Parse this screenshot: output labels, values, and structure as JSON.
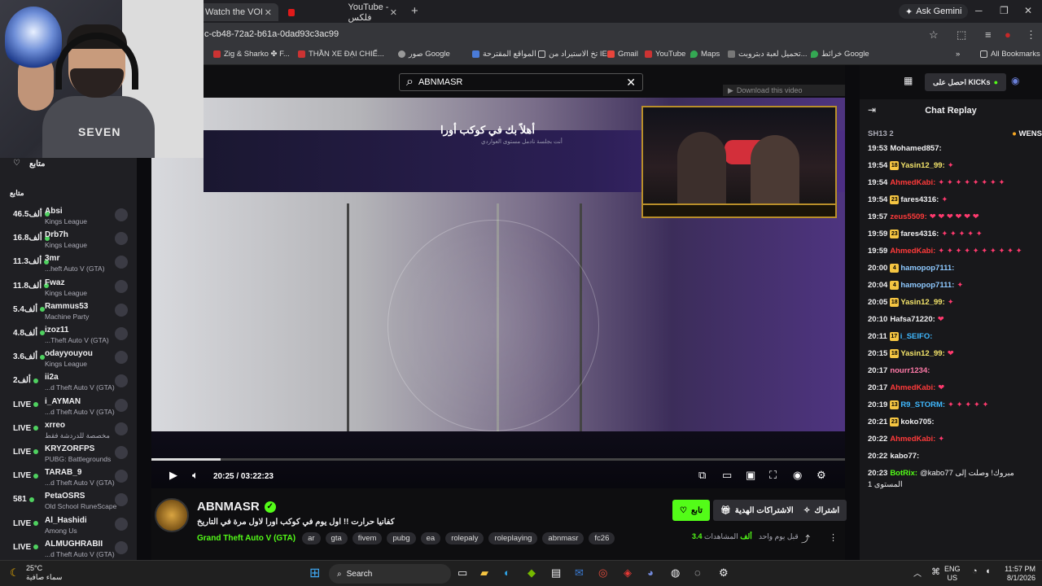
{
  "browser": {
    "tabs": [
      {
        "label": "Watch the VOD on",
        "close": "✕"
      },
      {
        "label": "YouTube - فلكس",
        "close": "✕"
      }
    ],
    "new_tab": "+",
    "ask_gemini": "Ask Gemini",
    "url": "c-cb48-72a2-b61a-0dad93c3ac99",
    "bookmarks": [
      "Zig & Sharko ✤ F...",
      "THẦN XE ĐẠI CHIẾ...",
      "صور Google",
      "المواقع المقترحة",
      "تخ الاستيراد من IE",
      "Gmail",
      "YouTube",
      "Maps",
      "تحميل لعبة دبتروبت...",
      "خرائط Google"
    ],
    "all_bookmarks": "All Bookmarks"
  },
  "webcam": {
    "shirt_text": "SEVEN"
  },
  "sidebar": {
    "following_label": "متابع",
    "section_label": "متابع",
    "channels": [
      {
        "count": "46.5",
        "unit": "ألف",
        "name": "Absi",
        "game": "Kings League"
      },
      {
        "count": "16.8",
        "unit": "ألف",
        "name": "Drb7h",
        "game": "Kings League"
      },
      {
        "count": "11.3",
        "unit": "ألف",
        "name": "3mr",
        "game": "...heft Auto V (GTA)"
      },
      {
        "count": "11.8",
        "unit": "ألف",
        "name": "Fwaz",
        "game": "Kings League"
      },
      {
        "count": "5.4",
        "unit": "ألف",
        "name": "Rammus53",
        "game": "Machine Party"
      },
      {
        "count": "4.8",
        "unit": "ألف",
        "name": "izoz11",
        "game": "...Theft Auto V (GTA)"
      },
      {
        "count": "3.6",
        "unit": "ألف",
        "name": "odayyouyou",
        "game": "Kings League"
      },
      {
        "count": "2",
        "unit": "ألف",
        "name": "ii2a",
        "game": "...d Theft Auto V (GTA)"
      },
      {
        "count": "LIVE",
        "unit": "",
        "name": "i_AYMAN",
        "game": "...d Theft Auto V (GTA)"
      },
      {
        "count": "LIVE",
        "unit": "",
        "name": "xrreo",
        "game": "مخصصة للدردشة فقط"
      },
      {
        "count": "LIVE",
        "unit": "",
        "name": "KRYZORFPS",
        "game": "PUBG: Battlegrounds"
      },
      {
        "count": "LIVE",
        "unit": "",
        "name": "TARAB_9",
        "game": "...d Theft Auto V (GTA)"
      },
      {
        "count": "581",
        "unit": "",
        "name": "PetaOSRS",
        "game": "Old School RuneScape"
      },
      {
        "count": "LIVE",
        "unit": "",
        "name": "Al_Hashidi",
        "game": "Among Us"
      },
      {
        "count": "LIVE",
        "unit": "",
        "name": "ALMUGHRABII",
        "game": "...d Theft Auto V (GTA)"
      }
    ]
  },
  "player": {
    "search_value": "ABNMASR",
    "download_label": "Download this video",
    "video_title": "أهلاً بك في كوكب أورا",
    "video_sub": "أنت بجلسة نادمل مستوى العواردي",
    "current_time": "20:25",
    "duration": "03:22:23",
    "progress": 0.1
  },
  "stream": {
    "name": "ABNMASR",
    "title": "كفانيا حرارت !! اول يوم في كوكب اورا لاول مرة في التاريخ",
    "game": "Grand Theft Auto V (GTA)",
    "tags": [
      "ar",
      "gta",
      "fivem",
      "pubg",
      "ea",
      "rolepaly",
      "roleplaying",
      "abnmasr",
      "fc26"
    ],
    "follow_label": "تابع",
    "gift_label": "الاشتراكات الهدية",
    "subscribe_label": "اشتراك",
    "viewers": "3.4 ألف",
    "viewers_label": "المشاهدات",
    "ago": "قبل يوم واحد"
  },
  "chat": {
    "kick_label": "احصل على KICKs",
    "header": "Chat Replay",
    "pinned_left": "SH13 2",
    "pinned_right": "WENS",
    "messages": [
      {
        "time": "19:53",
        "user": "Mohamed857:",
        "color": "#efeff1",
        "badge": "",
        "text": ""
      },
      {
        "time": "19:54",
        "user": "Yasin12_99:",
        "color": "#f5e56b",
        "badge": "18",
        "text": "✦"
      },
      {
        "time": "19:54",
        "user": "AhmedKabi:",
        "color": "#ff3a3a",
        "badge": "",
        "text": "✦ ✦ ✦ ✦ ✦ ✦ ✦ ✦"
      },
      {
        "time": "19:54",
        "user": "fares4316:",
        "color": "#efeff1",
        "badge": "23",
        "text": "✦"
      },
      {
        "time": "19:57",
        "user": "zeus5509:",
        "color": "#ff3a3a",
        "badge": "",
        "text": "❤ ❤ ❤ ❤ ❤ ❤"
      },
      {
        "time": "19:59",
        "user": "fares4316:",
        "color": "#efeff1",
        "badge": "23",
        "text": "✦ ✦ ✦ ✦ ✦"
      },
      {
        "time": "19:59",
        "user": "AhmedKabi:",
        "color": "#ff3a3a",
        "badge": "",
        "text": "✦ ✦ ✦ ✦ ✦ ✦ ✦ ✦ ✦ ✦"
      },
      {
        "time": "20:00",
        "user": "hamopop7111:",
        "color": "#8ec9ff",
        "badge": "4",
        "text": ""
      },
      {
        "time": "20:04",
        "user": "hamopop7111:",
        "color": "#8ec9ff",
        "badge": "4",
        "text": "✦"
      },
      {
        "time": "20:05",
        "user": "Yasin12_99:",
        "color": "#f5e56b",
        "badge": "18",
        "text": "✦"
      },
      {
        "time": "20:10",
        "user": "Hafsa71220:",
        "color": "#efeff1",
        "badge": "",
        "text": "❤"
      },
      {
        "time": "20:11",
        "user": "i_SEIFO:",
        "color": "#3fb9ff",
        "badge": "17",
        "text": ""
      },
      {
        "time": "20:15",
        "user": "Yasin12_99:",
        "color": "#f5e56b",
        "badge": "18",
        "text": "❤"
      },
      {
        "time": "20:17",
        "user": "nourr1234:",
        "color": "#ff7aa8",
        "badge": "",
        "text": ""
      },
      {
        "time": "20:17",
        "user": "AhmedKabi:",
        "color": "#ff3a3a",
        "badge": "",
        "text": "❤"
      },
      {
        "time": "20:19",
        "user": "R9_STORM:",
        "color": "#3fb9ff",
        "badge": "13",
        "text": "✦ ✦ ✦ ✦ ✦"
      },
      {
        "time": "20:21",
        "user": "koko705:",
        "color": "#efeff1",
        "badge": "23",
        "text": ""
      },
      {
        "time": "20:22",
        "user": "AhmedKabi:",
        "color": "#ff3a3a",
        "badge": "",
        "text": "✦"
      },
      {
        "time": "20:22",
        "user": "kabo77:",
        "color": "#efeff1",
        "badge": "",
        "text": ""
      },
      {
        "time": "20:23",
        "user": "BotRix:",
        "color": "#53fc18",
        "badge": "",
        "text": "@kabo77 مبروك! وصلت إلى المستوى 1"
      }
    ]
  },
  "taskbar": {
    "search_label": "Search",
    "weather_temp": "25°C",
    "weather_desc": "سماء صافية",
    "lang": "ENG",
    "region": "US",
    "time": "11:57 PM",
    "date": "8/1/2026"
  }
}
